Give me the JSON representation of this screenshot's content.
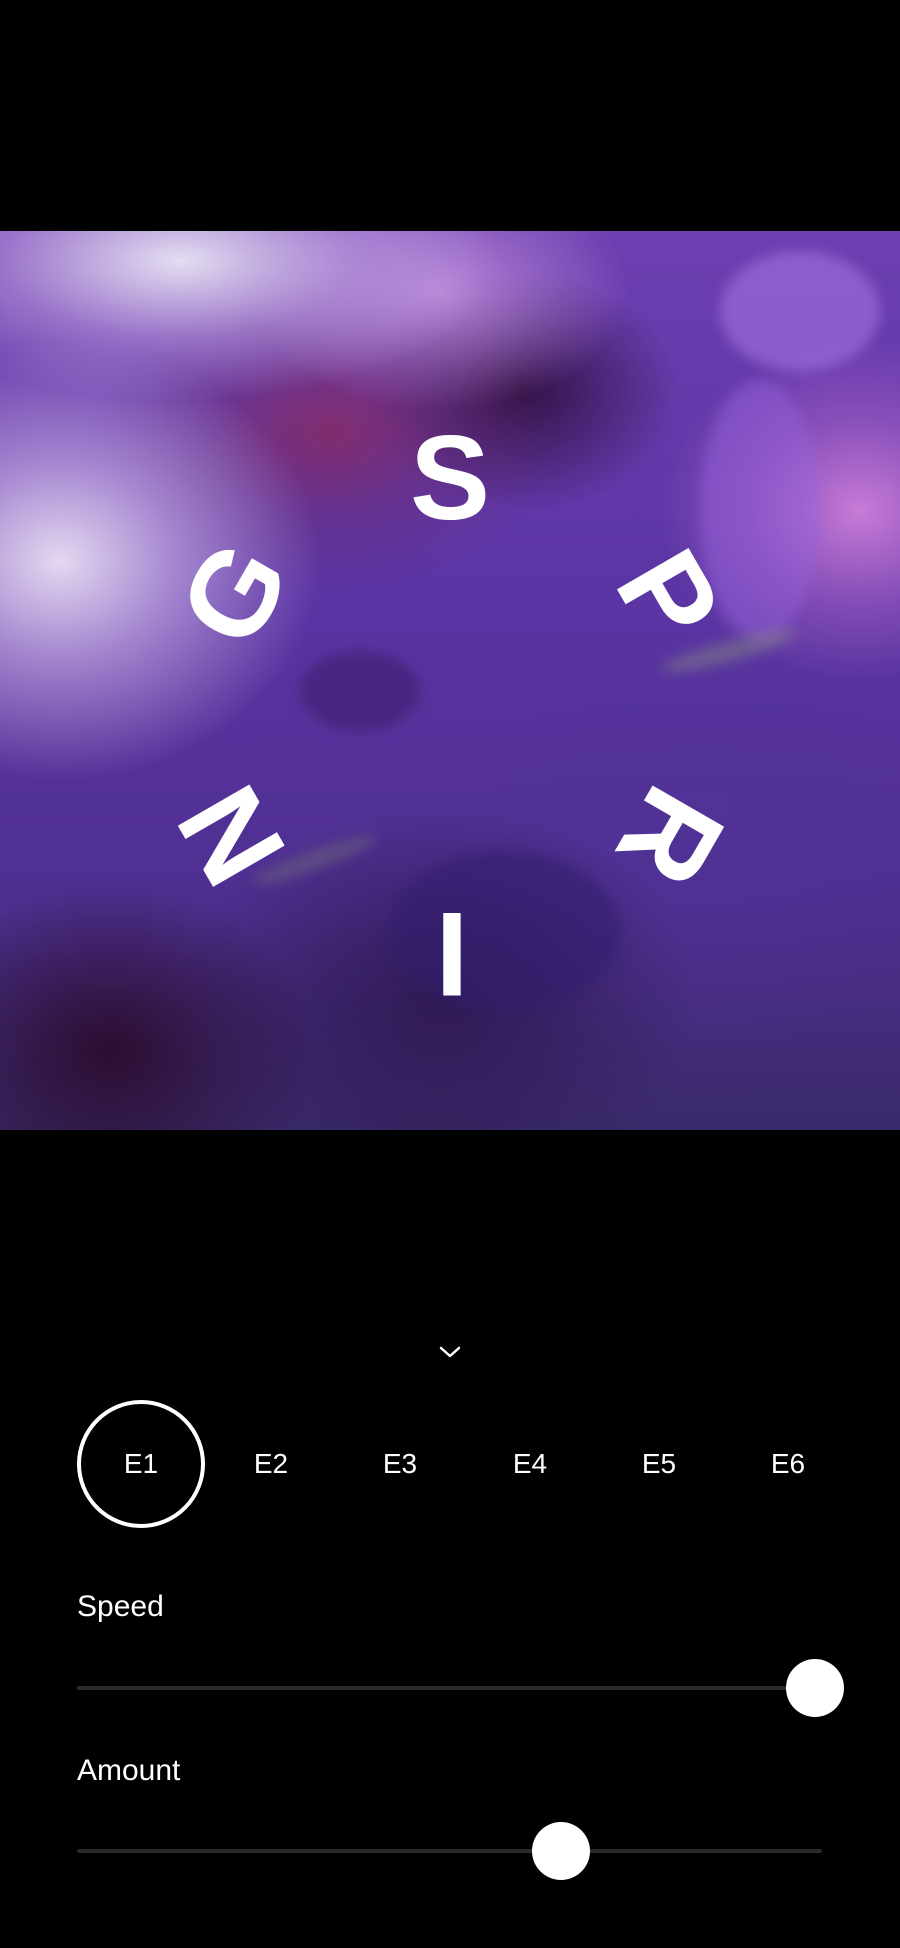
{
  "preview": {
    "title_letters": [
      "S",
      "P",
      "R",
      "I",
      "N",
      "G"
    ]
  },
  "collapse": {
    "icon": "chevron-down-icon"
  },
  "effects": {
    "selected": "E1",
    "items": [
      {
        "label": "E1"
      },
      {
        "label": "E2"
      },
      {
        "label": "E3"
      },
      {
        "label": "E4"
      },
      {
        "label": "E5"
      },
      {
        "label": "E6"
      }
    ]
  },
  "controls": {
    "speed": {
      "label": "Speed",
      "value": 0.99
    },
    "amount": {
      "label": "Amount",
      "value": 0.65
    }
  },
  "colors": {
    "background": "#000000",
    "accent": "#ffffff",
    "track": "#2a2a2a"
  }
}
